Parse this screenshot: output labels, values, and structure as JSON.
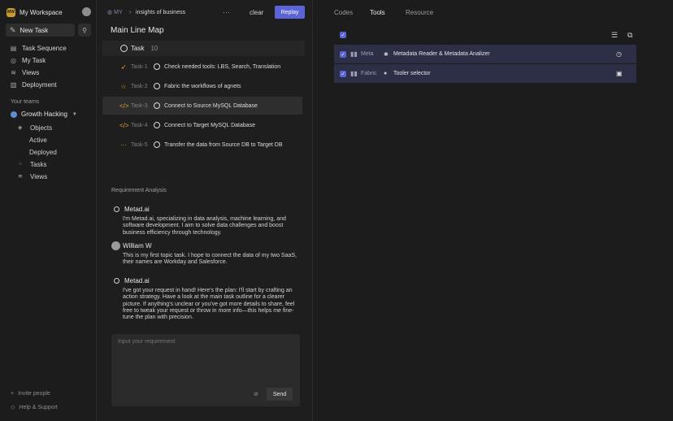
{
  "workspace": {
    "logo_text": "MW",
    "name": "My Workspace"
  },
  "sidebar": {
    "new_task": "New Task",
    "items": [
      {
        "label": "Task Sequence",
        "icon": "task-sequence-icon"
      },
      {
        "label": "My Task",
        "icon": "user-icon"
      },
      {
        "label": "Views",
        "icon": "layers-icon"
      },
      {
        "label": "Deployment",
        "icon": "book-icon"
      }
    ],
    "teams_label": "Your teams",
    "team": {
      "name": "Growth Hacking",
      "objects": "Objects",
      "active": "Active",
      "deployed": "Deployed",
      "tasks": "Tasks",
      "views": "Views"
    },
    "invite": "Invite people",
    "help": "Help & Support"
  },
  "topbar": {
    "tag": "MY",
    "breadcrumb": "insights of business",
    "more": "···",
    "clear": "clear",
    "replay": "Replay"
  },
  "main": {
    "title": "Main Line Map",
    "task_header": {
      "label": "Task",
      "count": "10"
    },
    "tasks": [
      {
        "id": "Task-1",
        "text": "Check needed tools: LBS, Search, Translation",
        "icon": "rocket-icon"
      },
      {
        "id": "Task-2",
        "text": "Fabric the workflows of agnets",
        "icon": "star-icon"
      },
      {
        "id": "Task-3",
        "text": "Connect to Source MySQL Database",
        "icon": "code-icon"
      },
      {
        "id": "Task-4",
        "text": "Connect to Target MySQL Database",
        "icon": "code-icon"
      },
      {
        "id": "Task-5",
        "text": "Transfer the data from Source DB to Target DB",
        "icon": "dots-icon"
      }
    ],
    "requirement_label": "Requirement Analysis",
    "messages": [
      {
        "name": "Metad.ai",
        "body": "I'm Metad.ai, specializing in data analysis, machine learning, and software development. I aim to solve data challenges and boost business efficiency through technology."
      },
      {
        "name": "William W",
        "body": "This is my first topic task. I hope to connect the data of my two SaaS, their names are Workday and Salesforce."
      },
      {
        "name": "Metad.ai",
        "body": "I've got your request in hand! Here's the plan: I'll start by crafting an action strategy. Have a look at the main task outline for a clearer picture. If anything's unclear or you've got more details to share, feel free to tweak your request or throw in more info—this helps me fine-tune the plan with precision."
      }
    ],
    "input_placeholder": "Input your requirement",
    "send": "Send"
  },
  "right": {
    "tabs": [
      "Codes",
      "Tools",
      "Resource"
    ],
    "active_tab": "Tools",
    "tools": [
      {
        "category": "Meta",
        "name": "Metadata Reader & Metadata Analizer",
        "icon": "gear-icon",
        "action": "clock-icon"
      },
      {
        "category": "Fabric",
        "name": "Tooler selector",
        "icon": "user-icon",
        "action": "box-icon"
      }
    ]
  },
  "colors": {
    "accent": "#5b63d6",
    "row_highlight": "#2c2f45",
    "workspace_logo": "#c99a2e"
  }
}
